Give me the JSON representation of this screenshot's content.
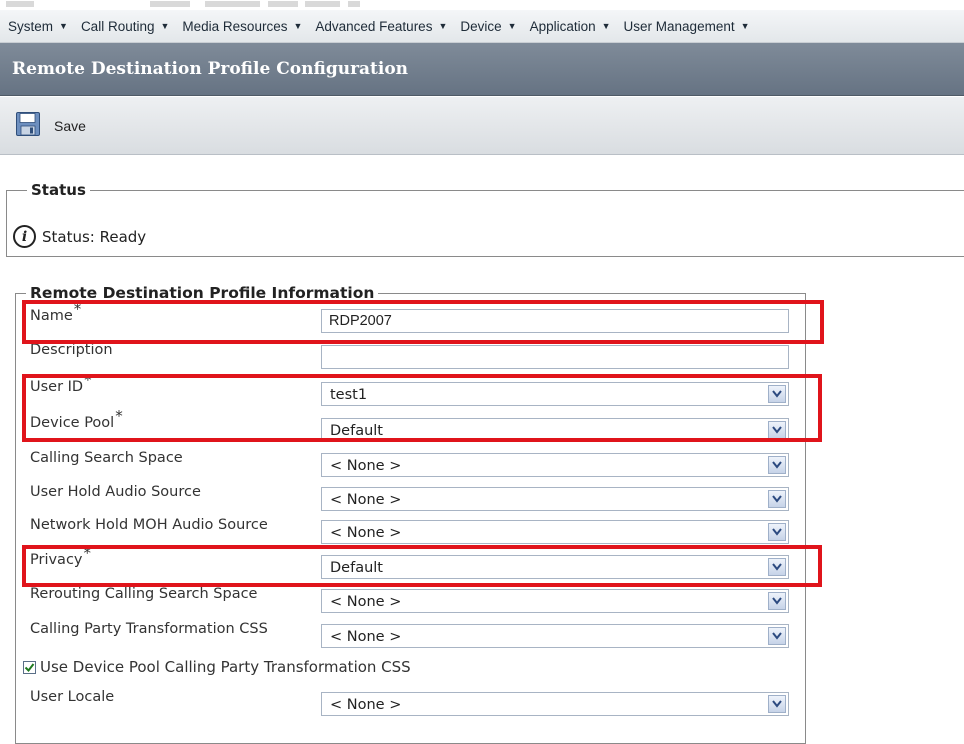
{
  "menu": [
    {
      "label": "System"
    },
    {
      "label": "Call Routing"
    },
    {
      "label": "Media Resources"
    },
    {
      "label": "Advanced Features"
    },
    {
      "label": "Device"
    },
    {
      "label": "Application"
    },
    {
      "label": "User Management"
    }
  ],
  "page_title": "Remote Destination Profile Configuration",
  "toolbar": {
    "save_label": "Save",
    "save_icon": "floppy-disk-icon"
  },
  "status": {
    "legend": "Status",
    "text": "Status: Ready",
    "icon": "info-icon"
  },
  "form": {
    "legend": "Remote Destination Profile Information",
    "required_marker": "*",
    "name": {
      "label": "Name",
      "value": "RDP2007"
    },
    "description": {
      "label": "Description",
      "value": ""
    },
    "user_id": {
      "label": "User ID",
      "value": "test1"
    },
    "device_pool": {
      "label": "Device Pool",
      "value": "Default"
    },
    "calling_search_space": {
      "label": "Calling Search Space",
      "value": "< None >"
    },
    "user_hold_audio_source": {
      "label": "User Hold Audio Source",
      "value": "< None >"
    },
    "network_hold_moh_audio_source": {
      "label": "Network Hold MOH Audio Source",
      "value": "< None >"
    },
    "privacy": {
      "label": "Privacy",
      "value": "Default"
    },
    "rerouting_calling_search_space": {
      "label": "Rerouting Calling Search Space",
      "value": "< None >"
    },
    "calling_party_transformation_css": {
      "label": "Calling Party Transformation CSS",
      "value": "< None >"
    },
    "use_device_pool_cpt_css": {
      "label": "Use Device Pool Calling Party Transformation CSS",
      "checked": true
    },
    "user_locale": {
      "label": "User Locale",
      "value": "< None >"
    }
  },
  "colors": {
    "highlight": "#e0141b",
    "titlebar": "#6f7b8a"
  }
}
